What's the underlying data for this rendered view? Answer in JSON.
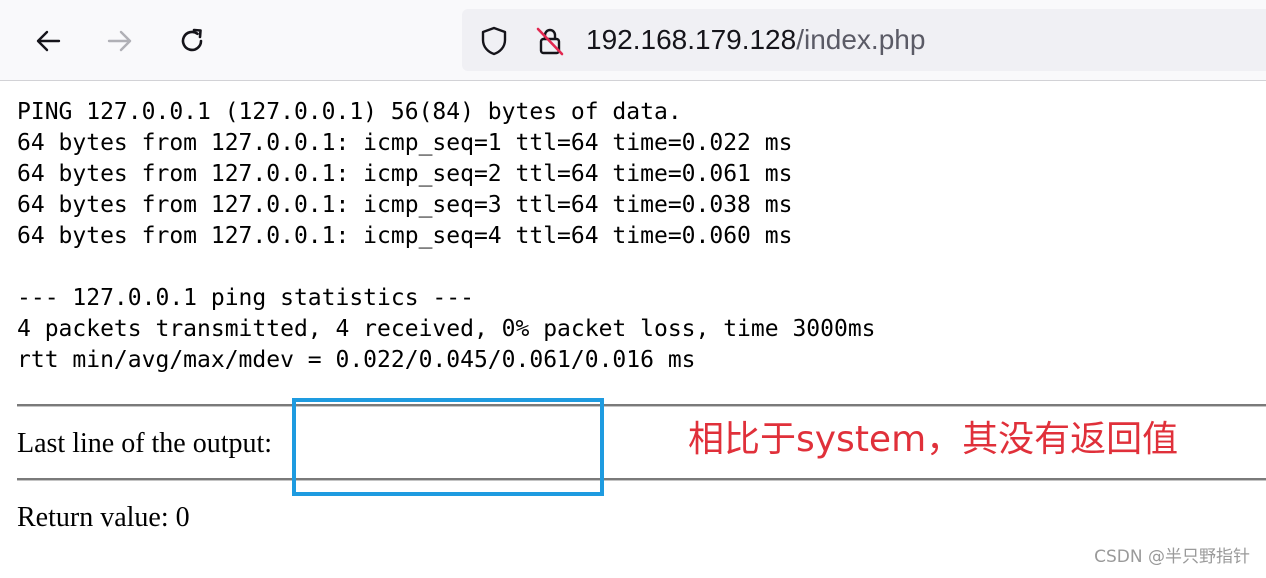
{
  "browser": {
    "url_host": "192.168.179.128",
    "url_path": "/index.php",
    "icons": {
      "back": "arrow-left-icon",
      "forward": "arrow-right-icon",
      "reload": "reload-icon",
      "tracking_protection": "shield-icon",
      "connection": "insecure-lock-icon"
    }
  },
  "page": {
    "ping_output": "PING 127.0.0.1 (127.0.0.1) 56(84) bytes of data.\n64 bytes from 127.0.0.1: icmp_seq=1 ttl=64 time=0.022 ms\n64 bytes from 127.0.0.1: icmp_seq=2 ttl=64 time=0.061 ms\n64 bytes from 127.0.0.1: icmp_seq=3 ttl=64 time=0.038 ms\n64 bytes from 127.0.0.1: icmp_seq=4 ttl=64 time=0.060 ms\n\n--- 127.0.0.1 ping statistics ---\n4 packets transmitted, 4 received, 0% packet loss, time 3000ms\nrtt min/avg/max/mdev = 0.022/0.045/0.061/0.016 ms",
    "last_line_label": "Last line of the output:",
    "return_value_label": "Return value: 0"
  },
  "annotation": {
    "text": "相比于system，其没有返回值",
    "color": "#e0303a",
    "box_color": "#1e9be0"
  },
  "watermark": "CSDN @半只野指针"
}
